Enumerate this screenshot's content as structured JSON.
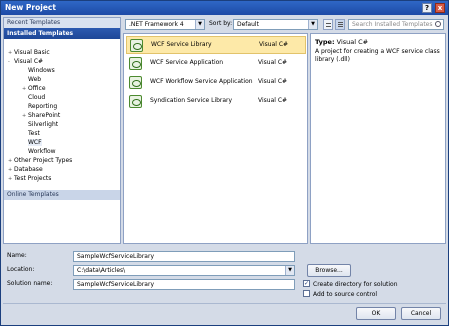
{
  "window": {
    "title": "New Project",
    "help_button": "?",
    "close_button": "x"
  },
  "left_panel": {
    "recent_tab": "Recent Templates",
    "installed_tab": "Installed Templates",
    "online_tab": "Online Templates",
    "tree": [
      {
        "label": "Visual Basic",
        "expander": "+"
      },
      {
        "label": "Visual C#",
        "expander": "-"
      },
      {
        "label": "Windows",
        "expander": ""
      },
      {
        "label": "Web",
        "expander": ""
      },
      {
        "label": "Office",
        "expander": "+"
      },
      {
        "label": "Cloud",
        "expander": ""
      },
      {
        "label": "Reporting",
        "expander": ""
      },
      {
        "label": "SharePoint",
        "expander": "+"
      },
      {
        "label": "Silverlight",
        "expander": ""
      },
      {
        "label": "Test",
        "expander": ""
      },
      {
        "label": "WCF",
        "expander": ""
      },
      {
        "label": "Workflow",
        "expander": ""
      },
      {
        "label": "Other Project Types",
        "expander": "+"
      },
      {
        "label": "Database",
        "expander": "+"
      },
      {
        "label": "Test Projects",
        "expander": "+"
      }
    ]
  },
  "toolbar": {
    "framework": ".NET Framework 4",
    "sort_label": "Sort by:",
    "sort_value": "Default",
    "search_placeholder": "Search Installed Templates"
  },
  "templates": [
    {
      "name": "WCF Service Library",
      "lang": "Visual C#"
    },
    {
      "name": "WCF Service Application",
      "lang": "Visual C#"
    },
    {
      "name": "WCF Workflow Service Application",
      "lang": "Visual C#"
    },
    {
      "name": "Syndication Service Library",
      "lang": "Visual C#"
    }
  ],
  "description": {
    "type_label": "Type:",
    "type_value": "Visual C#",
    "text": "A project for creating a WCF service class library (.dll)"
  },
  "form": {
    "name_label": "Name:",
    "name_value": "SampleWcfServiceLibrary",
    "location_label": "Location:",
    "location_value": "C:\\data\\Articles\\",
    "solution_label": "Solution name:",
    "solution_value": "SampleWcfServiceLibrary",
    "browse_label": "Browse...",
    "create_dir_label": "Create directory for solution",
    "source_control_label": "Add to source control",
    "ok_label": "OK",
    "cancel_label": "Cancel"
  }
}
